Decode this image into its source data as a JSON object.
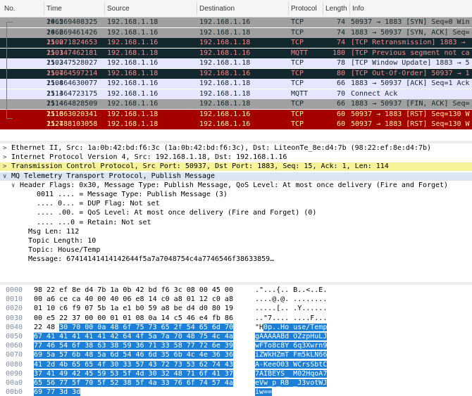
{
  "columns": {
    "no": "No.",
    "time": "Time",
    "source": "Source",
    "destination": "Destination",
    "protocol": "Protocol",
    "length": "Length",
    "info": "Info"
  },
  "packets": [
    {
      "no": "1065",
      "time": "24.269408325",
      "source": "192.168.1.18",
      "destination": "192.168.1.16",
      "protocol": "TCP",
      "length": "74",
      "info": "50937 → 1883 [SYN] Seq=0 Win",
      "bg": "#a0a0a0",
      "fg": "#12272e"
    },
    {
      "no": "1066",
      "time": "24.269461426",
      "source": "192.168.1.16",
      "destination": "192.168.1.18",
      "protocol": "TCP",
      "length": "74",
      "info": "1883 → 50937 [SYN, ACK] Seq=",
      "bg": "#a0a0a0",
      "fg": "#12272e"
    },
    {
      "no": "1100",
      "time": "25.271824653",
      "source": "192.168.1.16",
      "destination": "192.168.1.18",
      "protocol": "TCP",
      "length": "74",
      "info": "[TCP Retransmission] 1883 →",
      "bg": "#12272e",
      "fg": "#f78787"
    },
    {
      "no": "1101",
      "time": "25.347462181",
      "source": "192.168.1.18",
      "destination": "192.168.1.16",
      "protocol": "MQTT",
      "length": "180",
      "info": "[TCP Previous segment not ca",
      "bg": "#12272e",
      "fg": "#f78787"
    },
    {
      "no": "1102",
      "time": "25.347528027",
      "source": "192.168.1.16",
      "destination": "192.168.1.18",
      "protocol": "TCP",
      "length": "78",
      "info": "[TCP Window Update] 1883 → 5",
      "bg": "#e7e6ff",
      "fg": "#12272e"
    },
    {
      "no": "1107",
      "time": "25.464597214",
      "source": "192.168.1.18",
      "destination": "192.168.1.16",
      "protocol": "TCP",
      "length": "80",
      "info": "[TCP Out-Of-Order] 50937 → 1",
      "bg": "#12272e",
      "fg": "#f78787"
    },
    {
      "no": "1108",
      "time": "25.464630077",
      "source": "192.168.1.16",
      "destination": "192.168.1.18",
      "protocol": "TCP",
      "length": "66",
      "info": "1883 → 50937 [ACK] Seq=1 Ack",
      "bg": "#e7e6ff",
      "fg": "#12272e"
    },
    {
      "no": "1113",
      "time": "25.464723175",
      "source": "192.168.1.16",
      "destination": "192.168.1.18",
      "protocol": "MQTT",
      "length": "70",
      "info": "Connect Ack",
      "bg": "#e7e6ff",
      "fg": "#12272e"
    },
    {
      "no": "1114",
      "time": "25.464828509",
      "source": "192.168.1.16",
      "destination": "192.168.1.18",
      "protocol": "TCP",
      "length": "66",
      "info": "1883 → 50937 [FIN, ACK] Seq=",
      "bg": "#a0a0a0",
      "fg": "#12272e"
    },
    {
      "no": "1118",
      "time": "25.663020341",
      "source": "192.168.1.18",
      "destination": "192.168.1.16",
      "protocol": "TCP",
      "length": "60",
      "info": "50937 → 1883 [RST] Seq=130 W",
      "bg": "#a40000",
      "fg": "#fffc9c"
    },
    {
      "no": "1124",
      "time": "25.788103058",
      "source": "192.168.1.18",
      "destination": "192.168.1.16",
      "protocol": "TCP",
      "length": "60",
      "info": "50937 → 1883 [RST] Seq=130 W",
      "bg": "#a40000",
      "fg": "#fffc9c"
    }
  ],
  "details": [
    {
      "arrow": ">",
      "indent": 0,
      "text": "Ethernet II, Src: 1a:0b:42:bd:f6:3c (1a:0b:42:bd:f6:3c), Dst: LiteonTe_8e:d4:7b (98:22:ef:8e:d4:7b)",
      "bg": ""
    },
    {
      "arrow": ">",
      "indent": 0,
      "text": "Internet Protocol Version 4, Src: 192.168.1.18, Dst: 192.168.1.16",
      "bg": ""
    },
    {
      "arrow": ">",
      "indent": 0,
      "text": "Transmission Control Protocol, Src Port: 50937, Dst Port: 1883, Seq: 15, Ack: 1, Len: 114",
      "bg": "#f7f39a"
    },
    {
      "arrow": "v",
      "indent": 0,
      "text": "MQ Telemetry Transport Protocol, Publish Message",
      "bg": "#dce6f3"
    },
    {
      "arrow": "v",
      "indent": 1,
      "text": "Header Flags: 0x30, Message Type: Publish Message, QoS Level: At most once delivery (Fire and Forget)",
      "bg": ""
    },
    {
      "arrow": "",
      "indent": 3,
      "text": "0011 .... = Message Type: Publish Message (3)",
      "bg": ""
    },
    {
      "arrow": "",
      "indent": 3,
      "text": ".... 0... = DUP Flag: Not set",
      "bg": ""
    },
    {
      "arrow": "",
      "indent": 3,
      "text": ".... .00. = QoS Level: At most once delivery (Fire and Forget) (0)",
      "bg": ""
    },
    {
      "arrow": "",
      "indent": 3,
      "text": ".... ...0 = Retain: Not set",
      "bg": ""
    },
    {
      "arrow": "",
      "indent": 2,
      "text": "Msg Len: 112",
      "bg": ""
    },
    {
      "arrow": "",
      "indent": 2,
      "text": "Topic Length: 10",
      "bg": ""
    },
    {
      "arrow": "",
      "indent": 2,
      "text": "Topic: House/Temp",
      "bg": ""
    },
    {
      "arrow": "",
      "indent": 2,
      "text": "Message: 67414141414142644f5a7a7048754c4a7746546f38633859…",
      "bg": ""
    }
  ],
  "hex": [
    {
      "off": "0000",
      "pre": "98 22 ef 8e d4 7b 1a 0b  42 bd f6 3c 08 00 45 00",
      "hl": "",
      "apre": ".\"...{.. B..<..E.",
      "ahl": ""
    },
    {
      "off": "0010",
      "pre": "00 a6 ce ca 40 00 40 06  e8 14 c0 a8 01 12 c0 a8",
      "hl": "",
      "apre": "....@.@. ........",
      "ahl": ""
    },
    {
      "off": "0020",
      "pre": "01 10 c6 f9 07 5b 1a e1  b0 59 a8 be d4 d0 80 19",
      "hl": "",
      "apre": ".....[.. .Y......",
      "ahl": ""
    },
    {
      "off": "0030",
      "pre": "00 e5 22 37 00 00 01 01  08 0a 14 c5 46 e4 fb 86",
      "hl": "",
      "apre": "..\"7.... ....F...",
      "ahl": ""
    },
    {
      "off": "0040",
      "pre": "22 48 ",
      "hl": "30 70 00 0a 48 6f  75 73 65 2f 54 65 6d 70",
      "apre": "\"H",
      "ahl": "0p..Ho use/Temp"
    },
    {
      "off": "0050",
      "pre": "",
      "hl": "67 41 41 41 41 41 42 64  4f 5a 7a 70 48 75 4c 4a",
      "apre": "",
      "ahl": "gAAAAABd OZzpHuLJ"
    },
    {
      "off": "0060",
      "pre": "",
      "hl": "77 46 54 6f 38 63 38 59  36 71 33 58 77 72 6e 39",
      "apre": "",
      "ahl": "wFTo8c8Y 6q3Xwrn9"
    },
    {
      "off": "0070",
      "pre": "",
      "hl": "69 5a 57 6b 48 5a 6d 54  46 6d 35 6b 4c 4e 36 36",
      "apre": "",
      "ahl": "iZWkHZmT Fm5kLN66"
    },
    {
      "off": "0080",
      "pre": "",
      "hl": "41 2d 4b 65 65 4f 30 33  57 43 72 73 53 62 74 43",
      "apre": "",
      "ahl": "A-KeeO03 WCrsSbtC"
    },
    {
      "off": "0090",
      "pre": "",
      "hl": "37 41 49 42 45 59 53 5f  4d 30 32 48 71 6f 41 37",
      "apre": "",
      "ahl": "7AIBEYS_ M02HqoA7"
    },
    {
      "off": "00a0",
      "pre": "",
      "hl": "65 56 77 5f 70 5f 52 38  5f 4a 33 76 6f 74 57 4a",
      "apre": "",
      "ahl": "eVw_p_R8 _J3votWJ"
    },
    {
      "off": "00b0",
      "pre": "",
      "hl": "69 77 3d 3d",
      "apre": "",
      "ahl": "iw=="
    }
  ]
}
